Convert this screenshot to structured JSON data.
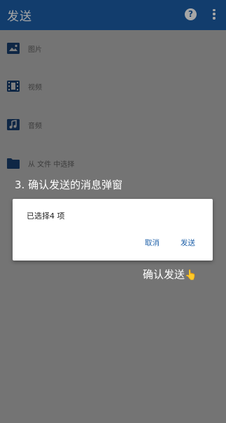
{
  "appbar": {
    "title": "发送",
    "help_icon": "question-circle-icon",
    "help_glyph": "?",
    "more_icon": "more-vert-icon"
  },
  "list": {
    "items": [
      {
        "label": "图片",
        "icon": "image-folder-icon"
      },
      {
        "label": "视频",
        "icon": "video-folder-icon"
      },
      {
        "label": "音频",
        "icon": "music-folder-icon"
      },
      {
        "label": "从 文件 中选择",
        "icon": "folder-icon"
      }
    ]
  },
  "annotation": {
    "top": "3. 确认发送的消息弹窗",
    "bottom": "确认发送",
    "pointer": "👆"
  },
  "dialog": {
    "message": "已选择4 项",
    "cancel_label": "取消",
    "send_label": "发送"
  },
  "colors": {
    "brand": "#1c5fa8",
    "accent_button": "#1c5fa8"
  }
}
